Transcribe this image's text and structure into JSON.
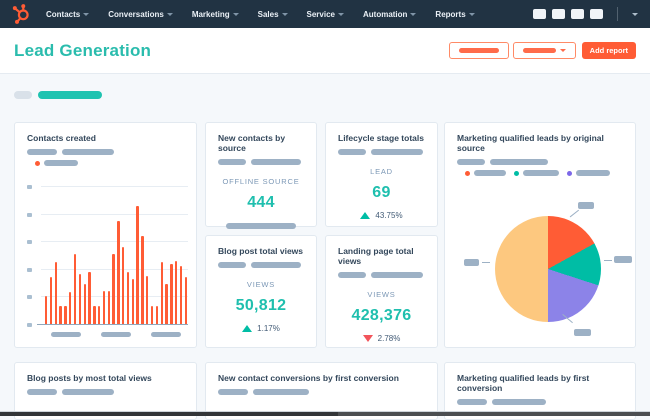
{
  "nav": {
    "items": [
      {
        "label": "Contacts"
      },
      {
        "label": "Conversations"
      },
      {
        "label": "Marketing"
      },
      {
        "label": "Sales"
      },
      {
        "label": "Service"
      },
      {
        "label": "Automation"
      },
      {
        "label": "Reports"
      }
    ]
  },
  "header": {
    "title": "Lead Generation",
    "add_report_label": "Add report"
  },
  "cards": {
    "contacts_created": {
      "title": "Contacts created"
    },
    "new_contacts_by_source": {
      "title": "New contacts by source",
      "metric_label": "OFFLINE SOURCE",
      "value": "444"
    },
    "lifecycle_stage_totals": {
      "title": "Lifecycle stage totals",
      "metric_label": "LEAD",
      "value": "69",
      "delta": "43.75%",
      "delta_direction": "up"
    },
    "mql_by_original_source": {
      "title": "Marketing qualified leads by original source"
    },
    "blog_post_total_views": {
      "title": "Blog post total views",
      "metric_label": "VIEWS",
      "value": "50,812",
      "delta": "1.17%",
      "delta_direction": "up"
    },
    "landing_page_total_views": {
      "title": "Landing page total views",
      "metric_label": "VIEWS",
      "value": "428,376",
      "delta": "2.78%",
      "delta_direction": "down"
    },
    "blog_posts_by_most_total_views": {
      "title": "Blog posts by most total views"
    },
    "new_contact_conversions": {
      "title": "New contact conversions by first conversion"
    },
    "mql_by_first_conversion": {
      "title": "Marketing qualified leads by first conversion"
    }
  },
  "chart_data": [
    {
      "type": "bar",
      "title": "Contacts created",
      "bar_color": "#ff5c35",
      "note": "axis tick labels and x-axis labels are placeholder pills; values are relative heights read from the chart (max gridline span = 138)",
      "values": [
        28,
        47,
        62,
        18,
        18,
        32,
        70,
        50,
        40,
        52,
        18,
        18,
        33,
        33,
        70,
        103,
        77,
        52,
        45,
        118,
        88,
        48,
        18,
        18,
        62,
        40,
        60,
        63,
        58,
        47
      ],
      "gridlines": true,
      "y_tick_count": 6,
      "x_tick_count": 3
    },
    {
      "type": "pie",
      "title": "Marketing qualified leads by original source",
      "start_angle_deg": 0,
      "slices": [
        {
          "label": "placeholder",
          "value": 17,
          "color": "#ff5c35"
        },
        {
          "label": "placeholder",
          "value": 13,
          "color": "#00bda5"
        },
        {
          "label": "placeholder",
          "value": 20,
          "color": "#8c83e8"
        },
        {
          "label": "placeholder",
          "value": 50,
          "color": "#fdc87f"
        }
      ],
      "legend_colors": [
        "#ff5c35",
        "#00bda5",
        "#7c68e8"
      ],
      "legend_position": "top"
    }
  ],
  "colors": {
    "accent_orange": "#ff5c35",
    "teal": "#1fbfae",
    "navy": "#213343",
    "negative_red": "#f2545b"
  }
}
